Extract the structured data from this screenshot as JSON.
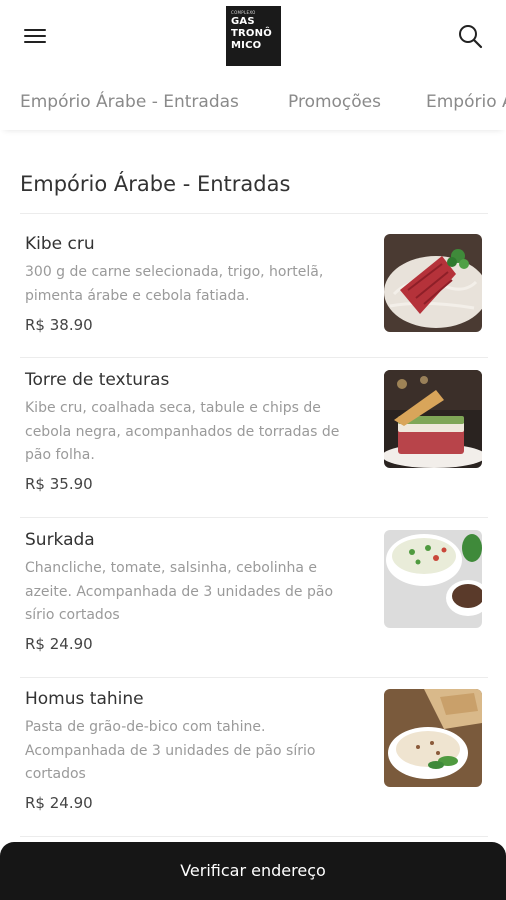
{
  "header": {
    "logo_small": "COMPLEXO",
    "logo_lines": [
      "GAS",
      "TRONÔ",
      "MICO"
    ]
  },
  "tabs": [
    {
      "label": "Empório Árabe - Entradas"
    },
    {
      "label": "Promoções"
    },
    {
      "label": "Empório Árabe"
    }
  ],
  "section": {
    "title": "Empório Árabe - Entradas"
  },
  "items": [
    {
      "name": "Kibe cru",
      "desc": "300 g de carne selecionada, trigo, hortelã, pimenta árabe e cebola fatiada.",
      "price": "R$ 38.90"
    },
    {
      "name": "Torre de texturas",
      "desc": "Kibe cru, coalhada seca, tabule e chips de cebola negra, acompanhados de torradas de pão folha.",
      "price": "R$ 35.90"
    },
    {
      "name": "Surkada",
      "desc": "Chancliche, tomate, salsinha, cebolinha e azeite. Acompanhada de 3 unidades de pão sírio cortados",
      "price": "R$ 24.90"
    },
    {
      "name": "Homus tahine",
      "desc": "Pasta de grão-de-bico com tahine. Acompanhada de 3 unidades de pão sírio cortados",
      "price": "R$ 24.90"
    }
  ],
  "bottom_bar": {
    "label": "Verificar endereço"
  },
  "icons": {
    "menu": "menu-icon",
    "search": "search-icon"
  }
}
